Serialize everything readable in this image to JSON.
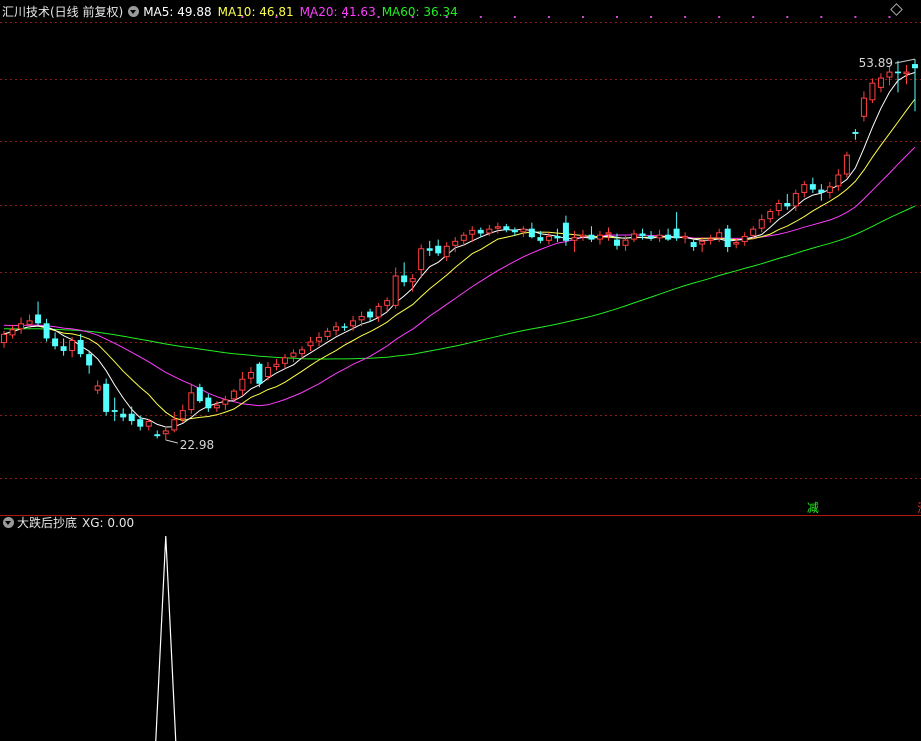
{
  "main_panel": {
    "title": "汇川技术(日线 前复权)",
    "ma": [
      {
        "label": "MA5: 49.88",
        "color": "#ffffff"
      },
      {
        "label": "MA10: 46.81",
        "color": "#ffff4d"
      },
      {
        "label": "MA20: 41.63",
        "color": "#ff3dff"
      },
      {
        "label": "MA60: 36.34",
        "color": "#22ee22"
      }
    ],
    "high_label": "53.89",
    "low_label": "22.98",
    "signals": [
      {
        "text": "减",
        "color": "#22ee22"
      },
      {
        "text": "涨",
        "color": "#ff3030"
      },
      {
        "text": "$",
        "color": "#ff3030"
      }
    ]
  },
  "sub_panel": {
    "title": "大跌后抄底",
    "value_label": "XG: 0.00"
  },
  "colors": {
    "up": "#ff4040",
    "down": "#54ffff",
    "grid": "#8b1a1a",
    "border": "#b01818"
  },
  "chart_data": [
    {
      "type": "candlestick",
      "ylim": [
        20,
        57
      ],
      "y_scale": "log",
      "grid": "horizontal-dashed",
      "candles": [
        {
          "o": 28.5,
          "h": 29.3,
          "l": 28.2,
          "c": 29.1
        },
        {
          "o": 29.0,
          "h": 29.7,
          "l": 28.8,
          "c": 29.4
        },
        {
          "o": 29.4,
          "h": 30.2,
          "l": 29.1,
          "c": 29.8
        },
        {
          "o": 29.7,
          "h": 30.4,
          "l": 29.4,
          "c": 30.0
        },
        {
          "o": 30.4,
          "h": 31.3,
          "l": 29.7,
          "c": 29.8
        },
        {
          "o": 29.8,
          "h": 30.1,
          "l": 28.6,
          "c": 28.8
        },
        {
          "o": 28.8,
          "h": 29.2,
          "l": 28.1,
          "c": 28.3
        },
        {
          "o": 28.3,
          "h": 28.8,
          "l": 27.7,
          "c": 28.0
        },
        {
          "o": 28.0,
          "h": 28.9,
          "l": 27.6,
          "c": 28.7
        },
        {
          "o": 28.7,
          "h": 29.1,
          "l": 27.6,
          "c": 27.8
        },
        {
          "o": 27.8,
          "h": 28.0,
          "l": 26.6,
          "c": 27.1
        },
        {
          "o": 25.6,
          "h": 26.2,
          "l": 25.4,
          "c": 25.9
        },
        {
          "o": 26.0,
          "h": 26.3,
          "l": 24.2,
          "c": 24.4
        },
        {
          "o": 24.5,
          "h": 25.2,
          "l": 23.9,
          "c": 24.4
        },
        {
          "o": 24.3,
          "h": 24.6,
          "l": 23.9,
          "c": 24.1
        },
        {
          "o": 24.3,
          "h": 24.7,
          "l": 23.7,
          "c": 23.9
        },
        {
          "o": 24.0,
          "h": 24.2,
          "l": 23.4,
          "c": 23.6
        },
        {
          "o": 23.6,
          "h": 24.0,
          "l": 23.4,
          "c": 23.9
        },
        {
          "o": 23.2,
          "h": 23.4,
          "l": 22.98,
          "c": 23.1
        },
        {
          "o": 23.2,
          "h": 23.6,
          "l": 22.9,
          "c": 23.4
        },
        {
          "o": 23.4,
          "h": 24.4,
          "l": 23.3,
          "c": 24.0
        },
        {
          "o": 24.0,
          "h": 24.8,
          "l": 23.8,
          "c": 24.5
        },
        {
          "o": 24.5,
          "h": 26.0,
          "l": 24.3,
          "c": 25.5
        },
        {
          "o": 25.8,
          "h": 26.0,
          "l": 24.9,
          "c": 25.0
        },
        {
          "o": 25.2,
          "h": 25.4,
          "l": 24.4,
          "c": 24.6
        },
        {
          "o": 24.6,
          "h": 25.0,
          "l": 24.4,
          "c": 24.8
        },
        {
          "o": 24.8,
          "h": 25.3,
          "l": 24.5,
          "c": 25.1
        },
        {
          "o": 25.1,
          "h": 25.7,
          "l": 25.0,
          "c": 25.6
        },
        {
          "o": 25.6,
          "h": 26.7,
          "l": 25.3,
          "c": 26.3
        },
        {
          "o": 26.3,
          "h": 27.0,
          "l": 26.0,
          "c": 26.7
        },
        {
          "o": 27.2,
          "h": 27.3,
          "l": 25.8,
          "c": 26.0
        },
        {
          "o": 26.4,
          "h": 27.3,
          "l": 26.2,
          "c": 27.0
        },
        {
          "o": 27.0,
          "h": 27.5,
          "l": 26.8,
          "c": 27.2
        },
        {
          "o": 27.2,
          "h": 27.8,
          "l": 26.9,
          "c": 27.6
        },
        {
          "o": 27.6,
          "h": 28.1,
          "l": 27.3,
          "c": 27.9
        },
        {
          "o": 27.8,
          "h": 28.3,
          "l": 27.5,
          "c": 28.1
        },
        {
          "o": 28.3,
          "h": 28.9,
          "l": 28.0,
          "c": 28.6
        },
        {
          "o": 28.6,
          "h": 29.2,
          "l": 28.3,
          "c": 28.9
        },
        {
          "o": 28.9,
          "h": 29.5,
          "l": 28.7,
          "c": 29.3
        },
        {
          "o": 29.3,
          "h": 29.9,
          "l": 29.0,
          "c": 29.6
        },
        {
          "o": 29.6,
          "h": 29.8,
          "l": 29.3,
          "c": 29.5
        },
        {
          "o": 29.6,
          "h": 30.3,
          "l": 29.3,
          "c": 30.0
        },
        {
          "o": 30.0,
          "h": 30.6,
          "l": 29.6,
          "c": 30.3
        },
        {
          "o": 30.6,
          "h": 30.8,
          "l": 29.9,
          "c": 30.2
        },
        {
          "o": 30.2,
          "h": 31.2,
          "l": 29.9,
          "c": 31.0
        },
        {
          "o": 31.0,
          "h": 31.6,
          "l": 30.6,
          "c": 31.4
        },
        {
          "o": 31.0,
          "h": 33.8,
          "l": 30.8,
          "c": 33.2
        },
        {
          "o": 33.2,
          "h": 34.2,
          "l": 32.4,
          "c": 32.7
        },
        {
          "o": 32.7,
          "h": 33.3,
          "l": 32.0,
          "c": 33.0
        },
        {
          "o": 33.6,
          "h": 35.6,
          "l": 33.0,
          "c": 35.3
        },
        {
          "o": 35.3,
          "h": 35.9,
          "l": 34.7,
          "c": 35.1
        },
        {
          "o": 35.5,
          "h": 36.0,
          "l": 34.7,
          "c": 34.9
        },
        {
          "o": 34.6,
          "h": 35.8,
          "l": 34.3,
          "c": 35.5
        },
        {
          "o": 35.5,
          "h": 36.2,
          "l": 35.0,
          "c": 35.9
        },
        {
          "o": 35.9,
          "h": 36.6,
          "l": 35.5,
          "c": 36.4
        },
        {
          "o": 36.4,
          "h": 37.1,
          "l": 35.8,
          "c": 36.8
        },
        {
          "o": 36.8,
          "h": 37.0,
          "l": 36.2,
          "c": 36.5
        },
        {
          "o": 36.5,
          "h": 37.2,
          "l": 36.3,
          "c": 36.9
        },
        {
          "o": 36.9,
          "h": 37.4,
          "l": 36.5,
          "c": 37.1
        },
        {
          "o": 37.1,
          "h": 37.3,
          "l": 36.6,
          "c": 36.8
        },
        {
          "o": 36.8,
          "h": 37.0,
          "l": 36.3,
          "c": 36.6
        },
        {
          "o": 36.6,
          "h": 37.1,
          "l": 36.2,
          "c": 36.9
        },
        {
          "o": 36.9,
          "h": 37.4,
          "l": 36.1,
          "c": 36.2
        },
        {
          "o": 36.2,
          "h": 36.7,
          "l": 35.7,
          "c": 35.9
        },
        {
          "o": 35.9,
          "h": 36.6,
          "l": 35.6,
          "c": 36.3
        },
        {
          "o": 36.3,
          "h": 36.9,
          "l": 35.8,
          "c": 36.1
        },
        {
          "o": 37.4,
          "h": 38.0,
          "l": 35.5,
          "c": 35.9
        },
        {
          "o": 35.9,
          "h": 36.7,
          "l": 35.0,
          "c": 36.2
        },
        {
          "o": 36.2,
          "h": 36.8,
          "l": 35.9,
          "c": 36.4
        },
        {
          "o": 36.4,
          "h": 37.1,
          "l": 35.8,
          "c": 36.0
        },
        {
          "o": 36.0,
          "h": 36.7,
          "l": 35.6,
          "c": 36.4
        },
        {
          "o": 36.4,
          "h": 37.0,
          "l": 35.9,
          "c": 36.6
        },
        {
          "o": 36.0,
          "h": 36.5,
          "l": 35.2,
          "c": 35.5
        },
        {
          "o": 35.5,
          "h": 36.3,
          "l": 35.1,
          "c": 36.0
        },
        {
          "o": 36.0,
          "h": 36.8,
          "l": 35.8,
          "c": 36.5
        },
        {
          "o": 36.5,
          "h": 36.9,
          "l": 36.0,
          "c": 36.3
        },
        {
          "o": 36.3,
          "h": 36.7,
          "l": 35.9,
          "c": 36.1
        },
        {
          "o": 36.1,
          "h": 36.8,
          "l": 35.8,
          "c": 36.4
        },
        {
          "o": 36.4,
          "h": 36.9,
          "l": 35.9,
          "c": 36.0
        },
        {
          "o": 36.9,
          "h": 38.3,
          "l": 35.9,
          "c": 36.1
        },
        {
          "o": 36.1,
          "h": 36.6,
          "l": 35.7,
          "c": 36.3
        },
        {
          "o": 35.8,
          "h": 36.1,
          "l": 35.1,
          "c": 35.4
        },
        {
          "o": 35.6,
          "h": 36.2,
          "l": 35.0,
          "c": 35.9
        },
        {
          "o": 35.9,
          "h": 36.4,
          "l": 35.6,
          "c": 36.1
        },
        {
          "o": 36.1,
          "h": 36.9,
          "l": 35.8,
          "c": 36.6
        },
        {
          "o": 36.9,
          "h": 37.2,
          "l": 35.0,
          "c": 35.4
        },
        {
          "o": 35.6,
          "h": 36.1,
          "l": 35.3,
          "c": 35.8
        },
        {
          "o": 35.8,
          "h": 36.6,
          "l": 35.5,
          "c": 36.3
        },
        {
          "o": 36.3,
          "h": 37.1,
          "l": 36.0,
          "c": 36.9
        },
        {
          "o": 36.9,
          "h": 38.1,
          "l": 36.6,
          "c": 37.7
        },
        {
          "o": 37.7,
          "h": 38.6,
          "l": 37.4,
          "c": 38.4
        },
        {
          "o": 38.4,
          "h": 39.4,
          "l": 38.0,
          "c": 39.1
        },
        {
          "o": 39.1,
          "h": 39.9,
          "l": 38.5,
          "c": 38.8
        },
        {
          "o": 38.8,
          "h": 40.3,
          "l": 38.4,
          "c": 40.0
        },
        {
          "o": 40.0,
          "h": 41.1,
          "l": 39.6,
          "c": 40.8
        },
        {
          "o": 40.8,
          "h": 41.4,
          "l": 40.0,
          "c": 40.3
        },
        {
          "o": 40.3,
          "h": 40.8,
          "l": 39.3,
          "c": 40.0
        },
        {
          "o": 40.0,
          "h": 41.0,
          "l": 39.5,
          "c": 40.6
        },
        {
          "o": 40.6,
          "h": 42.2,
          "l": 40.2,
          "c": 41.7
        },
        {
          "o": 41.7,
          "h": 43.9,
          "l": 41.4,
          "c": 43.6
        },
        {
          "o": 45.9,
          "h": 46.2,
          "l": 45.1,
          "c": 45.7
        },
        {
          "o": 47.5,
          "h": 50.3,
          "l": 47.0,
          "c": 49.6
        },
        {
          "o": 49.3,
          "h": 51.8,
          "l": 49.0,
          "c": 51.3
        },
        {
          "o": 50.7,
          "h": 52.4,
          "l": 50.2,
          "c": 51.9
        },
        {
          "o": 51.9,
          "h": 53.3,
          "l": 51.0,
          "c": 52.6
        },
        {
          "o": 52.6,
          "h": 53.89,
          "l": 50.2,
          "c": 52.4
        },
        {
          "o": 52.3,
          "h": 53.4,
          "l": 51.1,
          "c": 52.6
        },
        {
          "o": 53.5,
          "h": 54.1,
          "l": 48.1,
          "c": 53.0
        }
      ]
    },
    {
      "type": "line",
      "series": [
        {
          "name": "XG",
          "spike_index": 19,
          "peak": 1,
          "baseline": 0
        }
      ],
      "ylim": [
        0,
        1
      ]
    }
  ]
}
